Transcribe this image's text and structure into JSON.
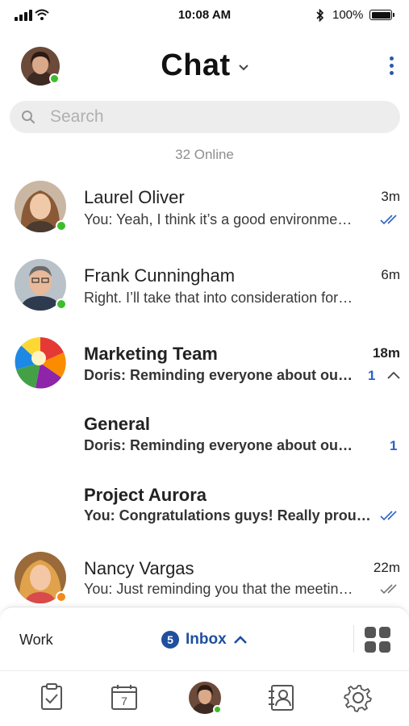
{
  "status_bar": {
    "time": "10:08 AM",
    "battery": "100%"
  },
  "header": {
    "title": "Chat"
  },
  "search": {
    "placeholder": "Search"
  },
  "online_count": "32 Online",
  "chats": [
    {
      "name": "Laurel Oliver",
      "preview": "You: Yeah, I think it’s a good environme…",
      "time": "3m",
      "status": "online"
    },
    {
      "name": "Frank Cunningham",
      "preview": "Right. I’ll take that into consideration for…",
      "time": "6m",
      "status": "online"
    },
    {
      "name": "Marketing Team",
      "preview": "Doris: Reminding everyone about our…",
      "time": "18m",
      "unread": "1"
    },
    {
      "name": "General",
      "preview": "Doris: Reminding everyone about our…",
      "unread": "1"
    },
    {
      "name": "Project Aurora",
      "preview": "You: Congratulations guys! Really proud…"
    },
    {
      "name": "Nancy Vargas",
      "preview": "You: Just reminding you that the meetin…",
      "time": "22m",
      "status": "away"
    }
  ],
  "bottom_panel": {
    "workspace": "Work",
    "inbox_count": "5",
    "inbox_label": "Inbox"
  },
  "tabbar": {
    "tabs": [
      {
        "icon": "tasks-icon"
      },
      {
        "icon": "calendar-icon",
        "day": "7"
      },
      {
        "icon": "profile-avatar"
      },
      {
        "icon": "contacts-icon"
      },
      {
        "icon": "settings-icon"
      }
    ]
  },
  "colors": {
    "accent": "#1f4f9e",
    "unread": "#2b63c4",
    "online": "#3dbd2b",
    "away": "#f08a1c"
  }
}
